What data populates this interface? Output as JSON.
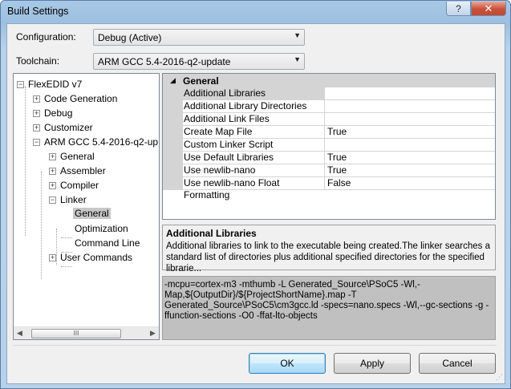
{
  "window": {
    "title": "Build Settings",
    "help_label": "?",
    "close_label": "✕"
  },
  "form": {
    "configuration_label": "Configuration:",
    "configuration_value": "Debug (Active)",
    "toolchain_label": "Toolchain:",
    "toolchain_value": "ARM GCC 5.4-2016-q2-update"
  },
  "tree": {
    "root": "FlexEDID v7",
    "items": {
      "code_generation": "Code Generation",
      "debug": "Debug",
      "customizer": "Customizer",
      "arm_gcc": "ARM GCC 5.4-2016-q2-up",
      "general": "General",
      "assembler": "Assembler",
      "compiler": "Compiler",
      "linker": "Linker",
      "linker_general": "General",
      "optimization": "Optimization",
      "command_line": "Command Line",
      "user_commands": "User Commands"
    },
    "expand_glyph": "+",
    "collapse_glyph": "−",
    "scroll_left": "◀",
    "scroll_right": "▶",
    "scroll_grip": "III"
  },
  "properties": {
    "category": "General",
    "category_glyph": "◢",
    "rows": [
      {
        "name": "Additional Libraries",
        "value": ""
      },
      {
        "name": "Additional Library Directories",
        "value": ""
      },
      {
        "name": "Additional Link Files",
        "value": ""
      },
      {
        "name": "Create Map File",
        "value": "True"
      },
      {
        "name": "Custom Linker Script",
        "value": ""
      },
      {
        "name": "Use Default Libraries",
        "value": "True"
      },
      {
        "name": "Use newlib-nano",
        "value": "True"
      },
      {
        "name": "Use newlib-nano Float Formatting",
        "value": "False"
      }
    ]
  },
  "description": {
    "title": "Additional Libraries",
    "text": "Additional libraries to link to the executable being created.The linker searches a standard list of directories plus additional specified directories for the specified librarie..."
  },
  "command_line": "-mcpu=cortex-m3 -mthumb -L Generated_Source\\PSoC5 -Wl,-Map,${OutputDir}/${ProjectShortName}.map -T Generated_Source\\PSoC5\\cm3gcc.ld -specs=nano.specs -Wl,--gc-sections -g -ffunction-sections -O0 -ffat-lto-objects",
  "buttons": {
    "ok": "OK",
    "apply": "Apply",
    "cancel": "Cancel"
  },
  "icons": {
    "dropdown_arrow": "▼",
    "resize_grip": "⋰"
  }
}
